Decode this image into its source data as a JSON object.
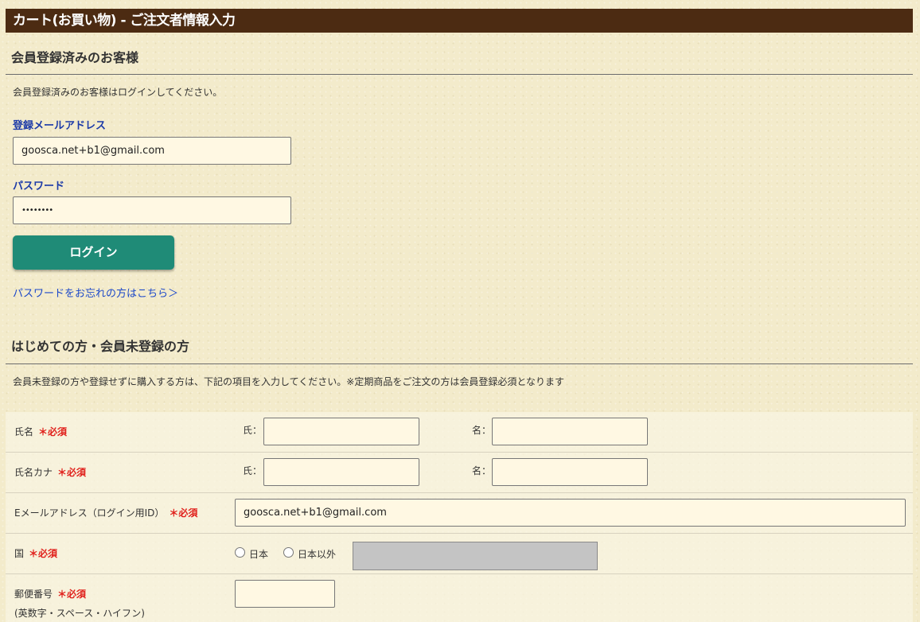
{
  "page_title": "カート(お買い物) - ご注文者情報入力",
  "member_section": {
    "title": "会員登録済みのお客様",
    "instruction": "会員登録済みのお客様はログインしてください。",
    "email_label": "登録メールアドレス",
    "email_value": "goosca.net+b1@gmail.com",
    "password_label": "パスワード",
    "password_value": "••••••••",
    "login_button": "ログイン",
    "forgot_link": "パスワードをお忘れの方はこちら＞"
  },
  "guest_section": {
    "title": "はじめての方・会員未登録の方",
    "instruction": "会員未登録の方や登録せずに購入する方は、下記の項目を入力してください。※定期商品をご注文の方は会員登録必須となります"
  },
  "form": {
    "required_mark": "＊必須",
    "name": {
      "label": "氏名",
      "last": "氏：",
      "first": "名："
    },
    "kana": {
      "label": "氏名カナ",
      "last": "氏：",
      "first": "名："
    },
    "email": {
      "label": "Eメールアドレス（ログイン用ID）",
      "value": "goosca.net+b1@gmail.com"
    },
    "country": {
      "label": "国",
      "option_japan": "日本",
      "option_other": "日本以外"
    },
    "postal": {
      "label": "郵便番号",
      "note": "(英数字・スペース・ハイフン)"
    }
  },
  "colors": {
    "header_bg": "#4c2b12",
    "accent_button": "#1f8b77",
    "label_blue": "#1c3aa8",
    "required_red": "#e0201b"
  }
}
